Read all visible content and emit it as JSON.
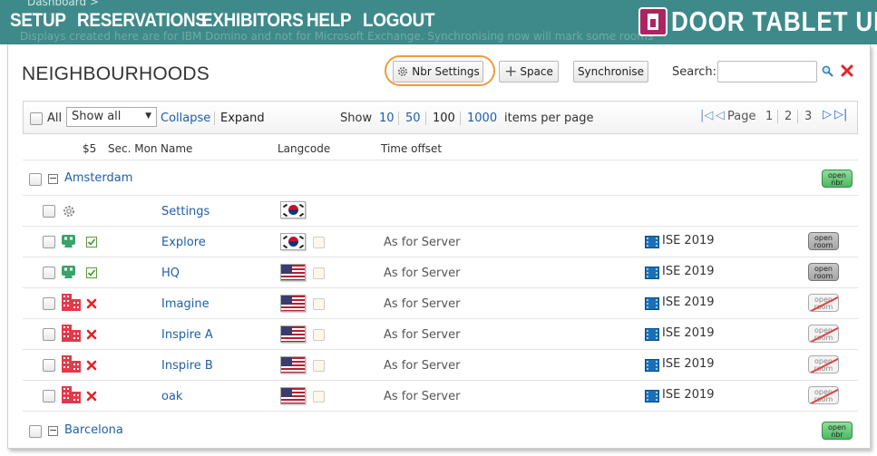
{
  "nav": {
    "breadcrumb": "Dashboard >",
    "background_text": "Displays created here are for IBM Domino and not for Microsoft Exchange. Synchronising now will mark some rooms",
    "items": [
      "SETUP",
      "RESERVATIONS",
      "EXHIBITORS",
      "HELP",
      "LOGOUT"
    ],
    "brand": "DOOR TABLET UI",
    "color": "#3e8a8a"
  },
  "page": {
    "title": "NEIGHBOURHOODS",
    "buttons": {
      "nbr_settings": "Nbr Settings",
      "space": "Space",
      "synchronise": "Synchronise"
    },
    "search_label": "Search:",
    "search_value": "",
    "highlight_color": "#f09a3c"
  },
  "toolbar": {
    "all_label": "All",
    "show_select": "Show all",
    "collapse": "Collapse",
    "expand": "Expand",
    "show_label": "Show",
    "page_sizes": [
      "10",
      "50",
      "100",
      "1000"
    ],
    "page_size_selected": "100",
    "per_page": "items per page",
    "page_label": "Page",
    "pages": [
      "1",
      "2",
      "3"
    ],
    "current_page": "1"
  },
  "columns": {
    "price": "$5",
    "sec_mon": "Sec. Mon",
    "name": "Name",
    "langcode": "Langcode",
    "time_offset": "Time offset"
  },
  "groups": [
    {
      "name": "Amsterdam",
      "badge": "open nbr"
    },
    {
      "name": "Barcelona",
      "badge": "open nbr"
    }
  ],
  "settings_row": {
    "name": "Settings",
    "flag": "kr"
  },
  "rooms": [
    {
      "name": "Explore",
      "flag": "kr",
      "time": "As for Server",
      "event": "ISE 2019",
      "type": "screen",
      "status": "edit",
      "badge": "open room",
      "badge_state": "enabled"
    },
    {
      "name": "HQ",
      "flag": "us",
      "time": "As for Server",
      "event": "ISE 2019",
      "type": "screen",
      "status": "edit",
      "badge": "open room",
      "badge_state": "enabled"
    },
    {
      "name": "Imagine",
      "flag": "us",
      "time": "As for Server",
      "event": "ISE 2019",
      "type": "building",
      "status": "error",
      "badge": "open room",
      "badge_state": "disabled"
    },
    {
      "name": "Inspire A",
      "flag": "us",
      "time": "As for Server",
      "event": "ISE 2019",
      "type": "building",
      "status": "error",
      "badge": "open room",
      "badge_state": "disabled"
    },
    {
      "name": "Inspire B",
      "flag": "us",
      "time": "As for Server",
      "event": "ISE 2019",
      "type": "building",
      "status": "error",
      "badge": "open room",
      "badge_state": "disabled"
    },
    {
      "name": "oak",
      "flag": "us",
      "time": "As for Server",
      "event": "ISE 2019",
      "type": "building",
      "status": "error",
      "badge": "open room",
      "badge_state": "disabled"
    }
  ],
  "icons": {
    "settings": "gear-icon",
    "search": "magnifier-icon",
    "clear": "close-icon",
    "screen": "tablet-icon",
    "building": "building-icon",
    "edit": "edit-check-icon",
    "error": "red-x-icon",
    "event": "film-icon"
  }
}
